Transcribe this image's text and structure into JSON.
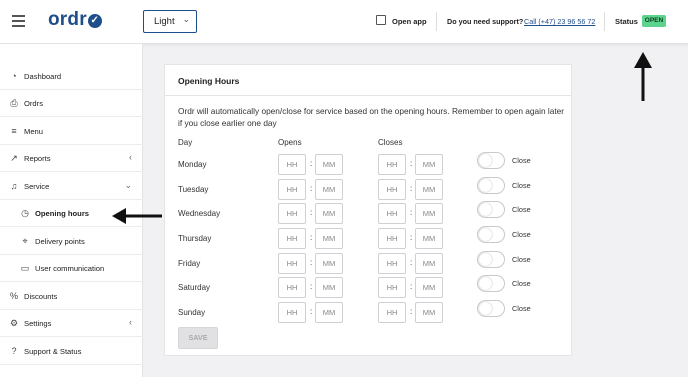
{
  "header": {
    "logo_text": "ordr",
    "logo_check": "✓",
    "theme_value": "Light",
    "open_app_label": "Open app",
    "support_question": "Do you need support?",
    "support_phone": "Call (+47) 23 96 56 72",
    "status_label": "Status",
    "status_value": "OPEN",
    "status_color": "#5cd48e",
    "brand_color": "#1f4e8c"
  },
  "sidebar": {
    "items": [
      {
        "label": "Dashboard",
        "icon": "dashboard-icon"
      },
      {
        "label": "Ordrs",
        "icon": "printer-icon"
      },
      {
        "label": "Menu",
        "icon": "menu-list-icon"
      },
      {
        "label": "Reports",
        "icon": "chart-trend-icon"
      },
      {
        "label": "Service",
        "icon": "bell-icon"
      },
      {
        "label": "Opening hours",
        "icon": "clock-icon"
      },
      {
        "label": "Delivery points",
        "icon": "pin-icon"
      },
      {
        "label": "User communication",
        "icon": "chat-icon"
      },
      {
        "label": "Discounts",
        "icon": "percent-icon"
      },
      {
        "label": "Settings",
        "icon": "gear-icon"
      },
      {
        "label": "Support & Status",
        "icon": "help-icon"
      }
    ]
  },
  "opening_hours": {
    "title": "Opening Hours",
    "description": "Ordr will automatically open/close for service based on the opening hours. Remember to open again later if you close earlier one day",
    "columns": {
      "day": "Day",
      "opens": "Opens",
      "closes": "Closes"
    },
    "hh_placeholder": "HH",
    "mm_placeholder": "MM",
    "separator": ":",
    "close_label": "Close",
    "save_label": "SAVE",
    "days": [
      "Monday",
      "Tuesday",
      "Wednesday",
      "Thursday",
      "Friday",
      "Saturday",
      "Sunday"
    ]
  }
}
